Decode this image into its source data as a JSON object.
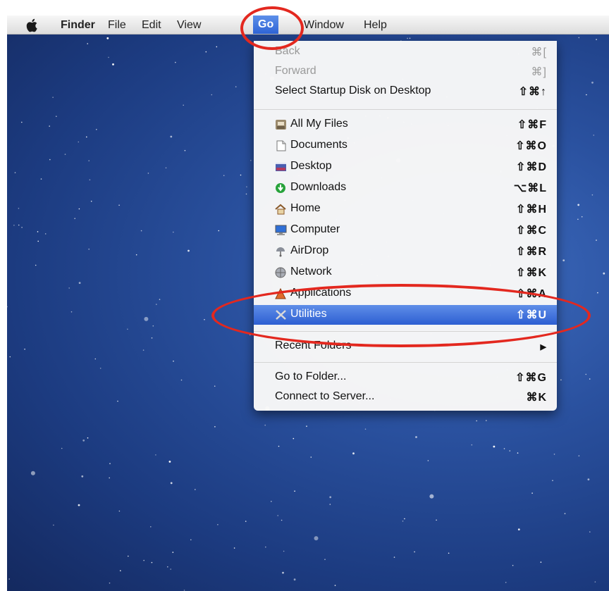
{
  "menubar": {
    "apple_symbol": "",
    "items": [
      "Finder",
      "File",
      "Edit",
      "View",
      "Go",
      "Window",
      "Help"
    ]
  },
  "go_menu": {
    "back": {
      "label": "Back",
      "shortcut": "⌘["
    },
    "forward": {
      "label": "Forward",
      "shortcut": "⌘]"
    },
    "startup": {
      "label": "Select Startup Disk on Desktop",
      "shortcut": "⇧⌘↑"
    },
    "places": [
      {
        "label": "All My Files",
        "shortcut": "⇧⌘F",
        "icon": "all-my-files-icon"
      },
      {
        "label": "Documents",
        "shortcut": "⇧⌘O",
        "icon": "documents-icon"
      },
      {
        "label": "Desktop",
        "shortcut": "⇧⌘D",
        "icon": "desktop-icon"
      },
      {
        "label": "Downloads",
        "shortcut": "⌥⌘L",
        "icon": "downloads-icon"
      },
      {
        "label": "Home",
        "shortcut": "⇧⌘H",
        "icon": "home-icon"
      },
      {
        "label": "Computer",
        "shortcut": "⇧⌘C",
        "icon": "computer-icon"
      },
      {
        "label": "AirDrop",
        "shortcut": "⇧⌘R",
        "icon": "airdrop-icon"
      },
      {
        "label": "Network",
        "shortcut": "⇧⌘K",
        "icon": "network-icon"
      },
      {
        "label": "Applications",
        "shortcut": "⇧⌘A",
        "icon": "applications-icon"
      },
      {
        "label": "Utilities",
        "shortcut": "⇧⌘U",
        "icon": "utilities-icon"
      }
    ],
    "recent_folders": {
      "label": "Recent Folders",
      "arrow": "▶"
    },
    "go_to_folder": {
      "label": "Go to Folder...",
      "shortcut": "⇧⌘G"
    },
    "connect_server": {
      "label": "Connect to Server...",
      "shortcut": "⌘K"
    }
  },
  "colors": {
    "highlight": "#2d5fd2",
    "annotation": "#e3281f",
    "desktop": "#1c3b80"
  }
}
